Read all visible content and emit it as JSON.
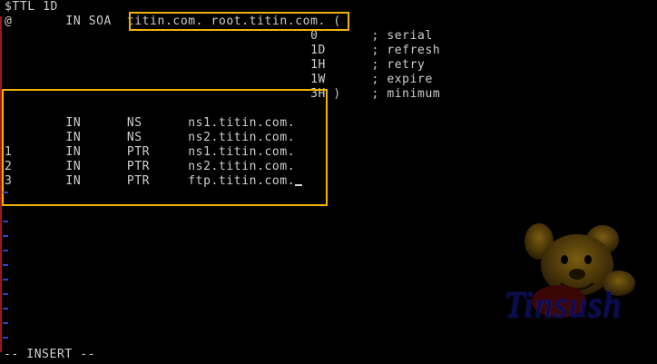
{
  "editor": {
    "lines": [
      "$TTL 1D",
      "@       IN SOA  titin.com. root.titin.com. (",
      "                                        0       ; serial",
      "                                        1D      ; refresh",
      "                                        1H      ; retry",
      "                                        1W      ; expire",
      "                                        3H )    ; minimum",
      "",
      "        IN      NS      ns1.titin.com.",
      "        IN      NS      ns2.titin.com.",
      "1       IN      PTR     ns1.titin.com.",
      "2       IN      PTR     ns2.titin.com.",
      "3       IN      PTR     ftp.titin.com."
    ],
    "mode": "-- INSERT --"
  },
  "wallpaper": {
    "signature": "Tinsush",
    "icon": "pooh-bear-icon"
  },
  "colors": {
    "background": "#000000",
    "text": "#cfcfcf",
    "highlight": "#f0b400",
    "tilde": "#2b46c9"
  }
}
